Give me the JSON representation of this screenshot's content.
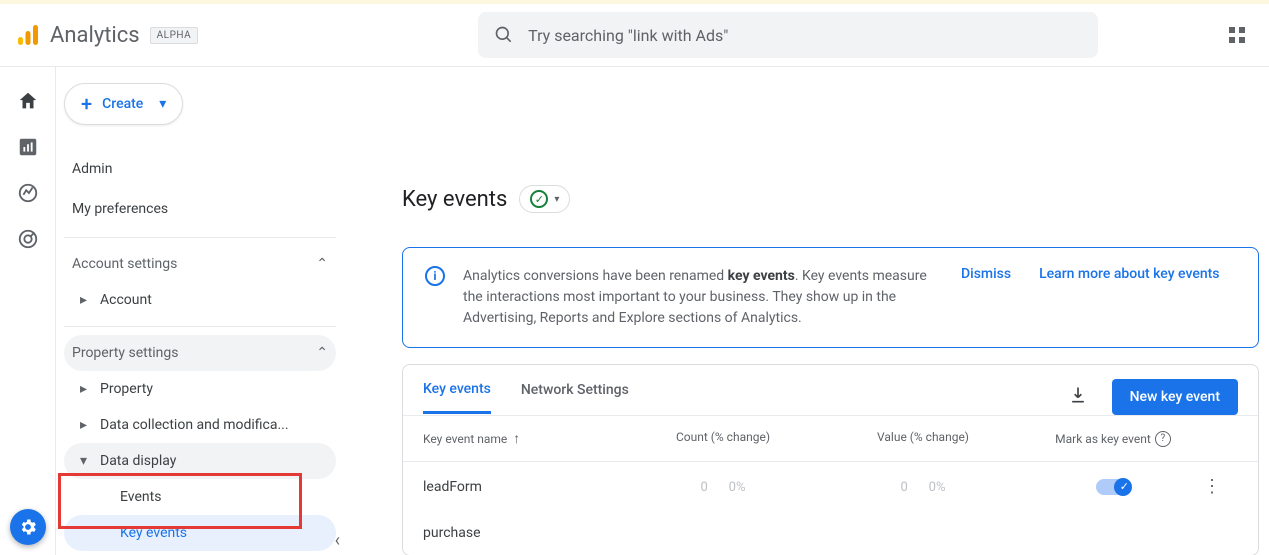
{
  "header": {
    "product": "Analytics",
    "badge": "ALPHA",
    "search_placeholder": "Try searching \"link with Ads\""
  },
  "sidebar": {
    "create_label": "Create",
    "admin": "Admin",
    "prefs": "My preferences",
    "account_settings": "Account settings",
    "account": "Account",
    "property_settings": "Property settings",
    "property": "Property",
    "data_collect": "Data collection and modifica...",
    "data_display": "Data display",
    "events": "Events",
    "key_events": "Key events"
  },
  "page": {
    "title": "Key events"
  },
  "banner": {
    "text_pre": "Analytics conversions have been renamed ",
    "text_bold": "key events",
    "text_post": ". Key events measure the interactions most important to your business. They show up in the Advertising, Reports and Explore sections of Analytics.",
    "dismiss": "Dismiss",
    "learn_more": "Learn more about key events"
  },
  "card": {
    "tabs": {
      "key_events": "Key events",
      "network": "Network Settings"
    },
    "new_btn": "New key event",
    "columns": {
      "name": "Key event name",
      "count": "Count (% change)",
      "value": "Value (% change)",
      "mark": "Mark as key event"
    },
    "rows": [
      {
        "name": "leadForm",
        "count": "0",
        "count_change": "0%",
        "value": "0",
        "value_change": "0%",
        "marked": true
      },
      {
        "name": "purchase"
      }
    ]
  }
}
